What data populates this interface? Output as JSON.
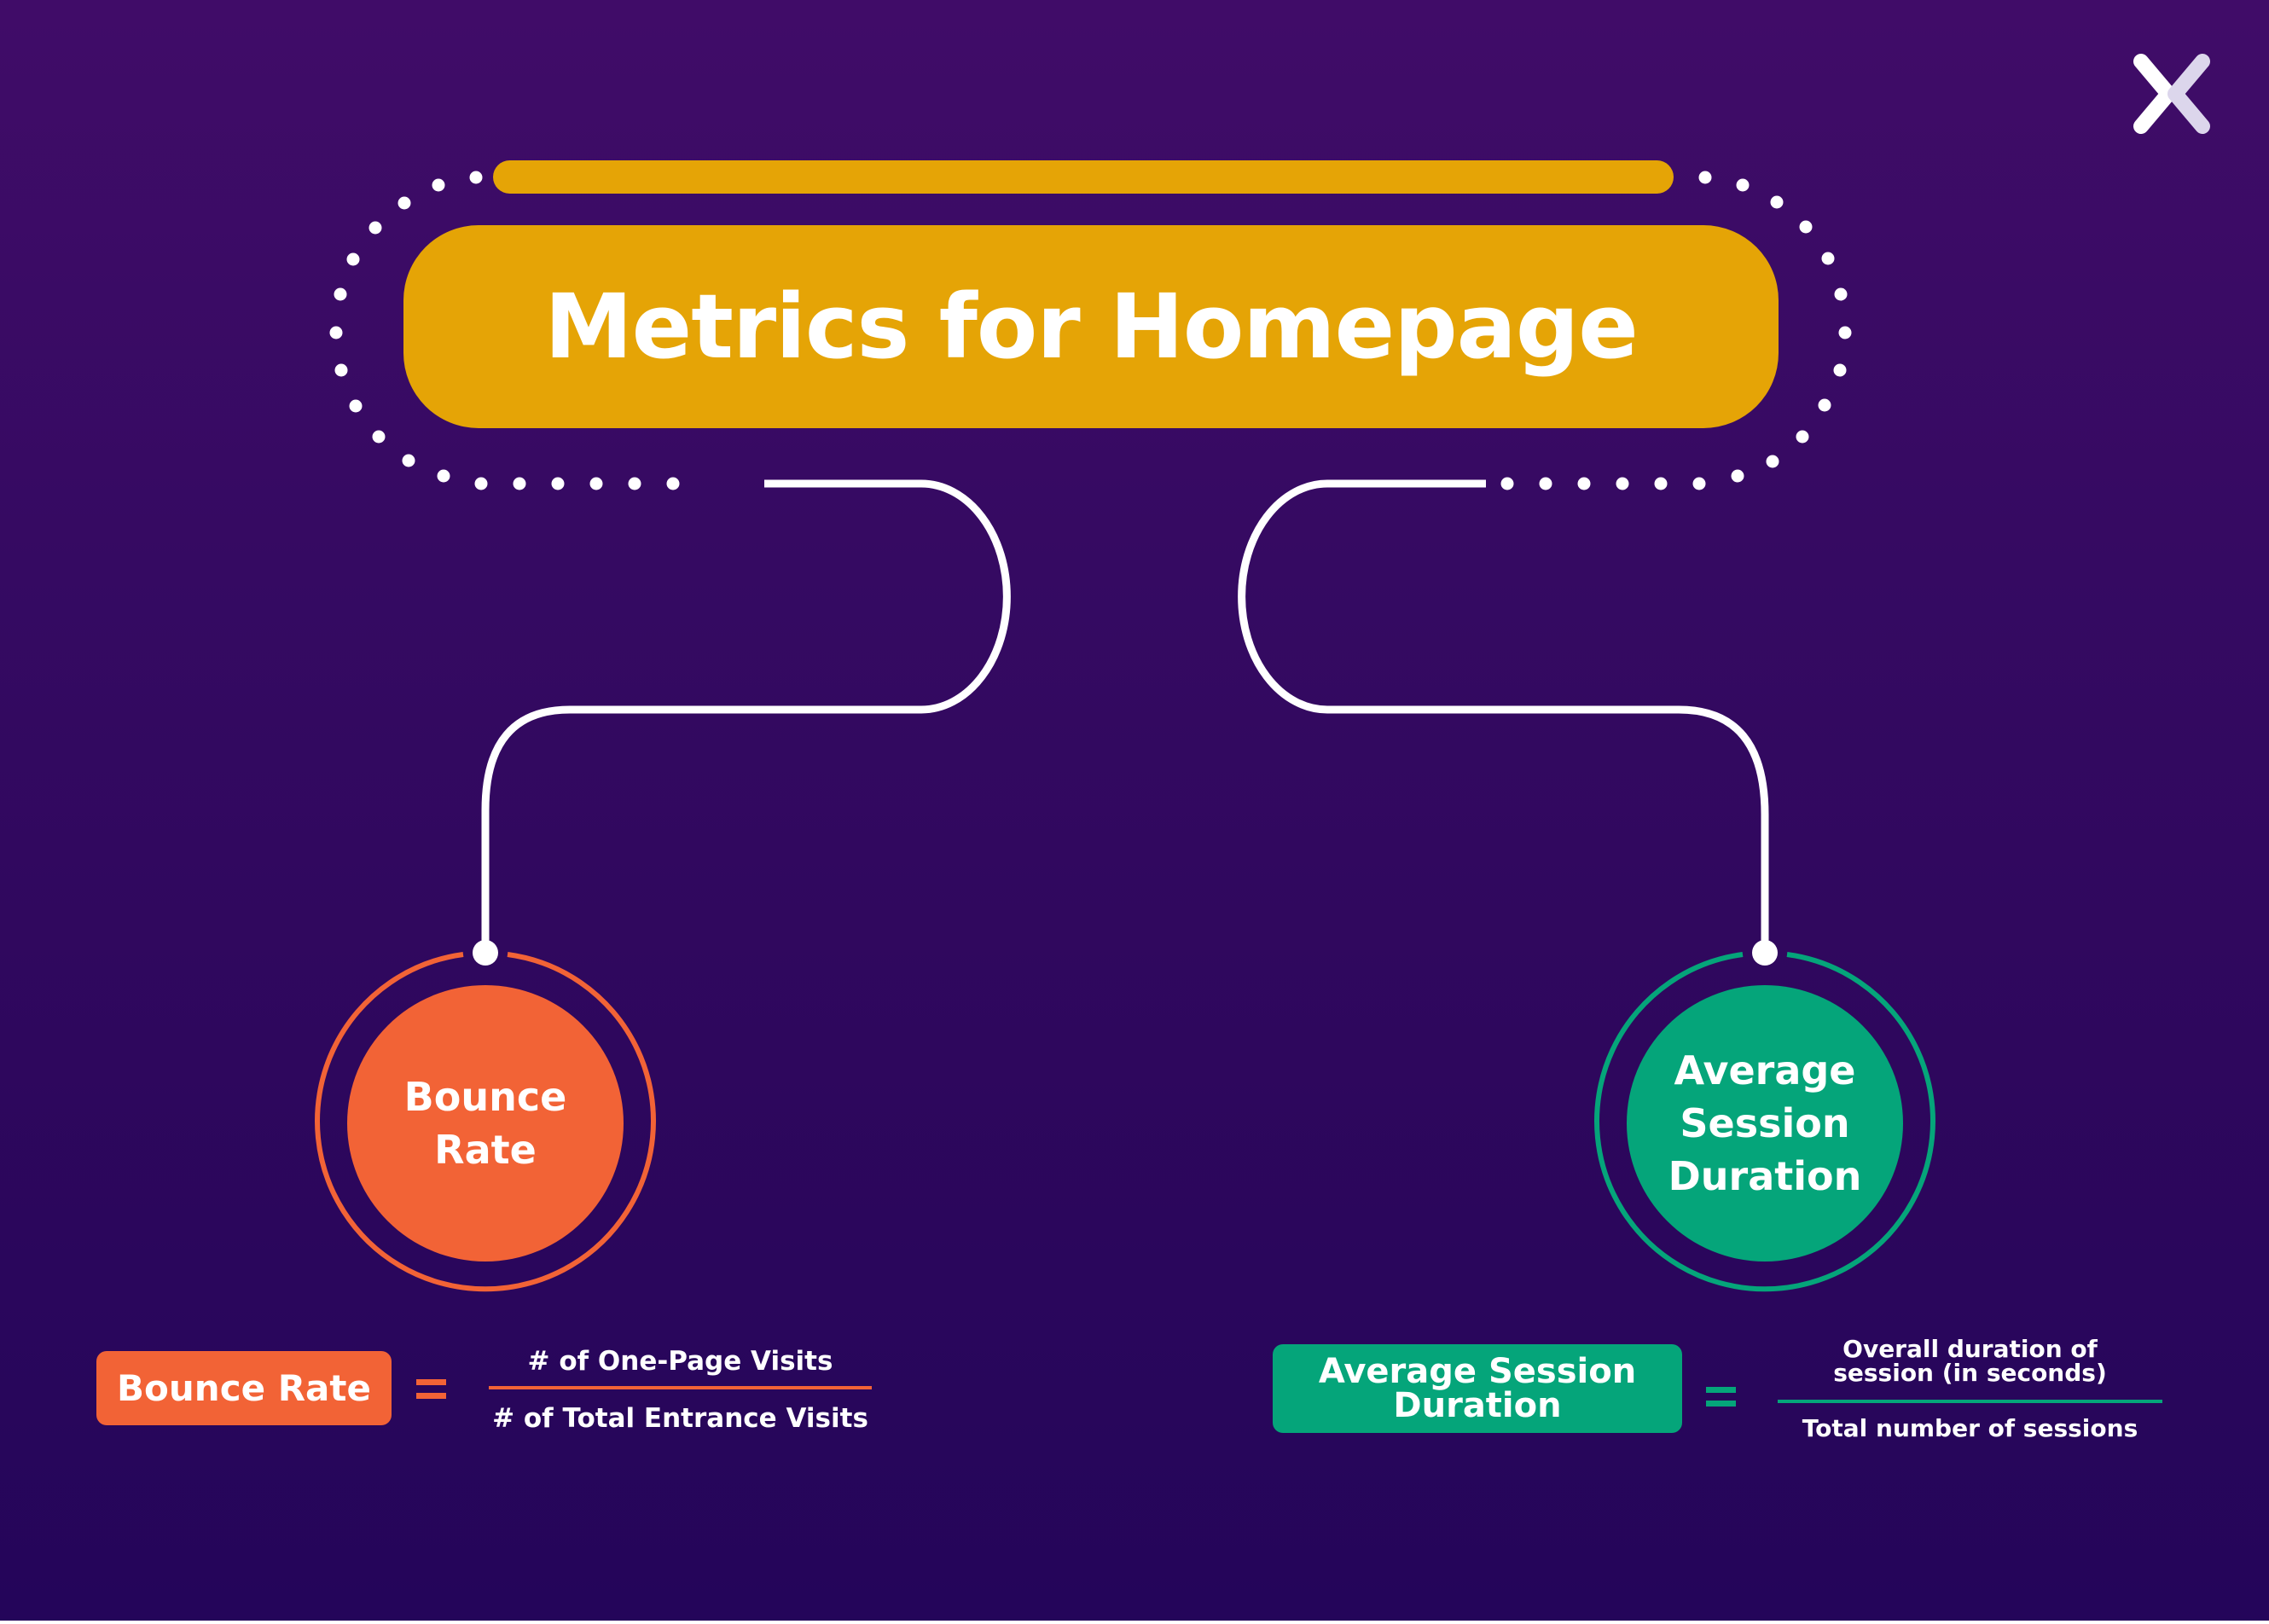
{
  "title": "Metrics for Homepage",
  "colors": {
    "background_top": "#400c68",
    "background_bottom": "#24055a",
    "title_fill": "#e5a406",
    "bounce_accent": "#f26336",
    "session_accent": "#05a57a",
    "connector": "#ffffff"
  },
  "logo": {
    "icon": "x-chevrons-logo-icon"
  },
  "metrics": [
    {
      "id": "bounce-rate",
      "circle_lines": [
        "Bounce",
        "Rate"
      ],
      "formula": {
        "label": "Bounce Rate",
        "operator": "=",
        "numerator": "# of One-Page Visits",
        "denominator": "# of Total Entrance Visits"
      }
    },
    {
      "id": "average-session-duration",
      "circle_lines": [
        "Average",
        "Session",
        "Duration"
      ],
      "formula": {
        "label_lines": [
          "Average Session",
          "Duration"
        ],
        "operator": "=",
        "numerator_lines": [
          "Overall duration of",
          "session (in seconds)"
        ],
        "denominator": "Total number of sessions"
      }
    }
  ]
}
